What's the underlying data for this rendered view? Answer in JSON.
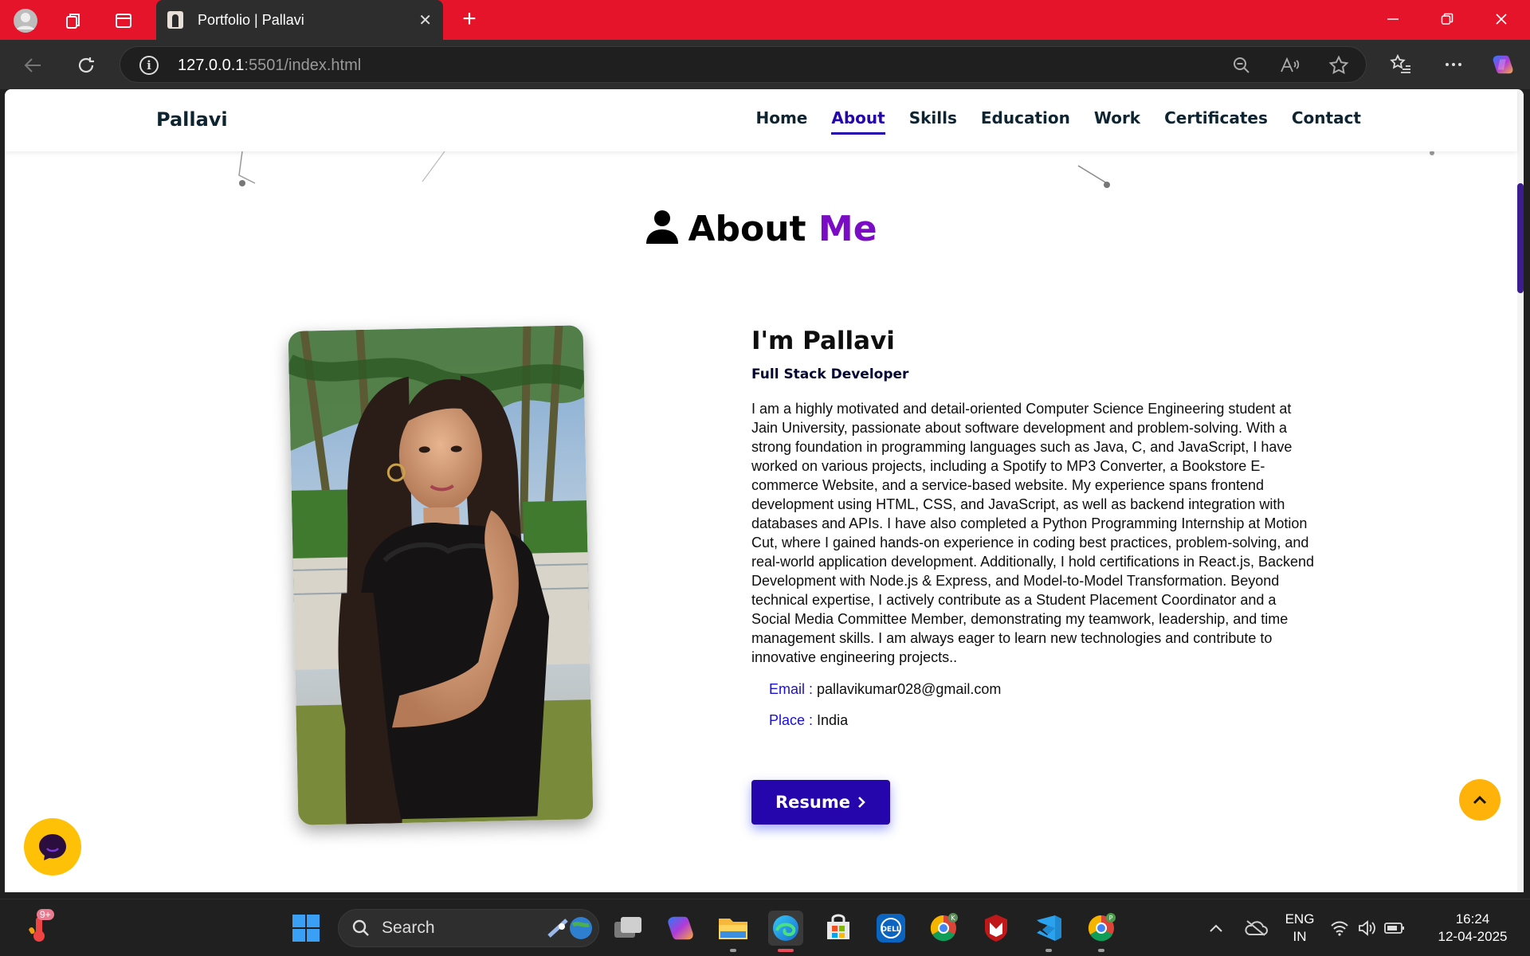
{
  "browser": {
    "tab_title": "Portfolio | Pallavi",
    "tab_close": "✕",
    "new_tab": "+",
    "url_host": "127.0.0.1",
    "url_rest": ":5501/index.html"
  },
  "site": {
    "brand": "Pallavi",
    "nav": [
      "Home",
      "About",
      "Skills",
      "Education",
      "Work",
      "Certificates",
      "Contact"
    ],
    "active_nav": "About"
  },
  "about": {
    "title_main": "About",
    "title_accent": "Me",
    "name": "I'm Pallavi",
    "role": "Full Stack Developer",
    "description": "I am a highly motivated and detail-oriented Computer Science Engineering student at Jain University, passionate about software development and problem-solving. With a strong foundation in programming languages such as Java, C, and JavaScript, I have worked on various projects, including a Spotify to MP3 Converter, a Bookstore E-commerce Website, and a service-based website. My experience spans frontend development using HTML, CSS, and JavaScript, as well as backend integration with databases and APIs. I have also completed a Python Programming Internship at Motion Cut, where I gained hands-on experience in coding best practices, problem-solving, and real-world application development. Additionally, I hold certifications in React.js, Backend Development with Node.js & Express, and Model-to-Model Transformation. Beyond technical expertise, I actively contribute as a Student Placement Coordinator and a Social Media Committee Member, demonstrating my teamwork, leadership, and time management skills. I am always eager to learn new technologies and contribute to innovative engineering projects..",
    "email_label": "Email :",
    "email": "pallavikumar028@gmail.com",
    "place_label": "Place :",
    "place": "India",
    "resume_label": "Resume"
  },
  "taskbar": {
    "search_placeholder": "Search",
    "weather_badge": "9+",
    "lang_line1": "ENG",
    "lang_line2": "IN",
    "time": "16:24",
    "date": "12-04-2025"
  },
  "colors": {
    "titlebar": "#e5142b",
    "accent_purple": "#7b0cc5",
    "nav_active": "#2506ad",
    "button": "#2506ad",
    "chat_button": "#ffc107",
    "top_button": "#ffb30a"
  }
}
